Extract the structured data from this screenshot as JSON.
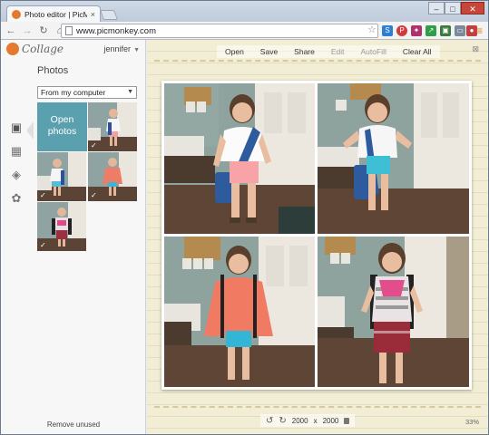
{
  "browser": {
    "tab_title": "Photo editor | PicMonkey",
    "tab_close": "×",
    "url": "www.picmonkey.com",
    "window_controls": {
      "minimize": "–",
      "maximize": "□",
      "close": "✕"
    }
  },
  "sidebar": {
    "logo": "Collage",
    "user": "jennifer",
    "section_title": "Photos",
    "source": "From my computer",
    "open_button_line1": "Open",
    "open_button_line2": "photos",
    "remove_unused": "Remove unused"
  },
  "menu": {
    "open": "Open",
    "save": "Save",
    "share": "Share",
    "edit": "Edit",
    "autofill": "AutoFill",
    "clear_all": "Clear All"
  },
  "footer": {
    "width": "2000",
    "x": "x",
    "height": "2000",
    "zoom": "33%"
  },
  "colors": {
    "accent": "#5aa0ae",
    "brand": "#e47a2e",
    "stage": "#f2edd5"
  }
}
